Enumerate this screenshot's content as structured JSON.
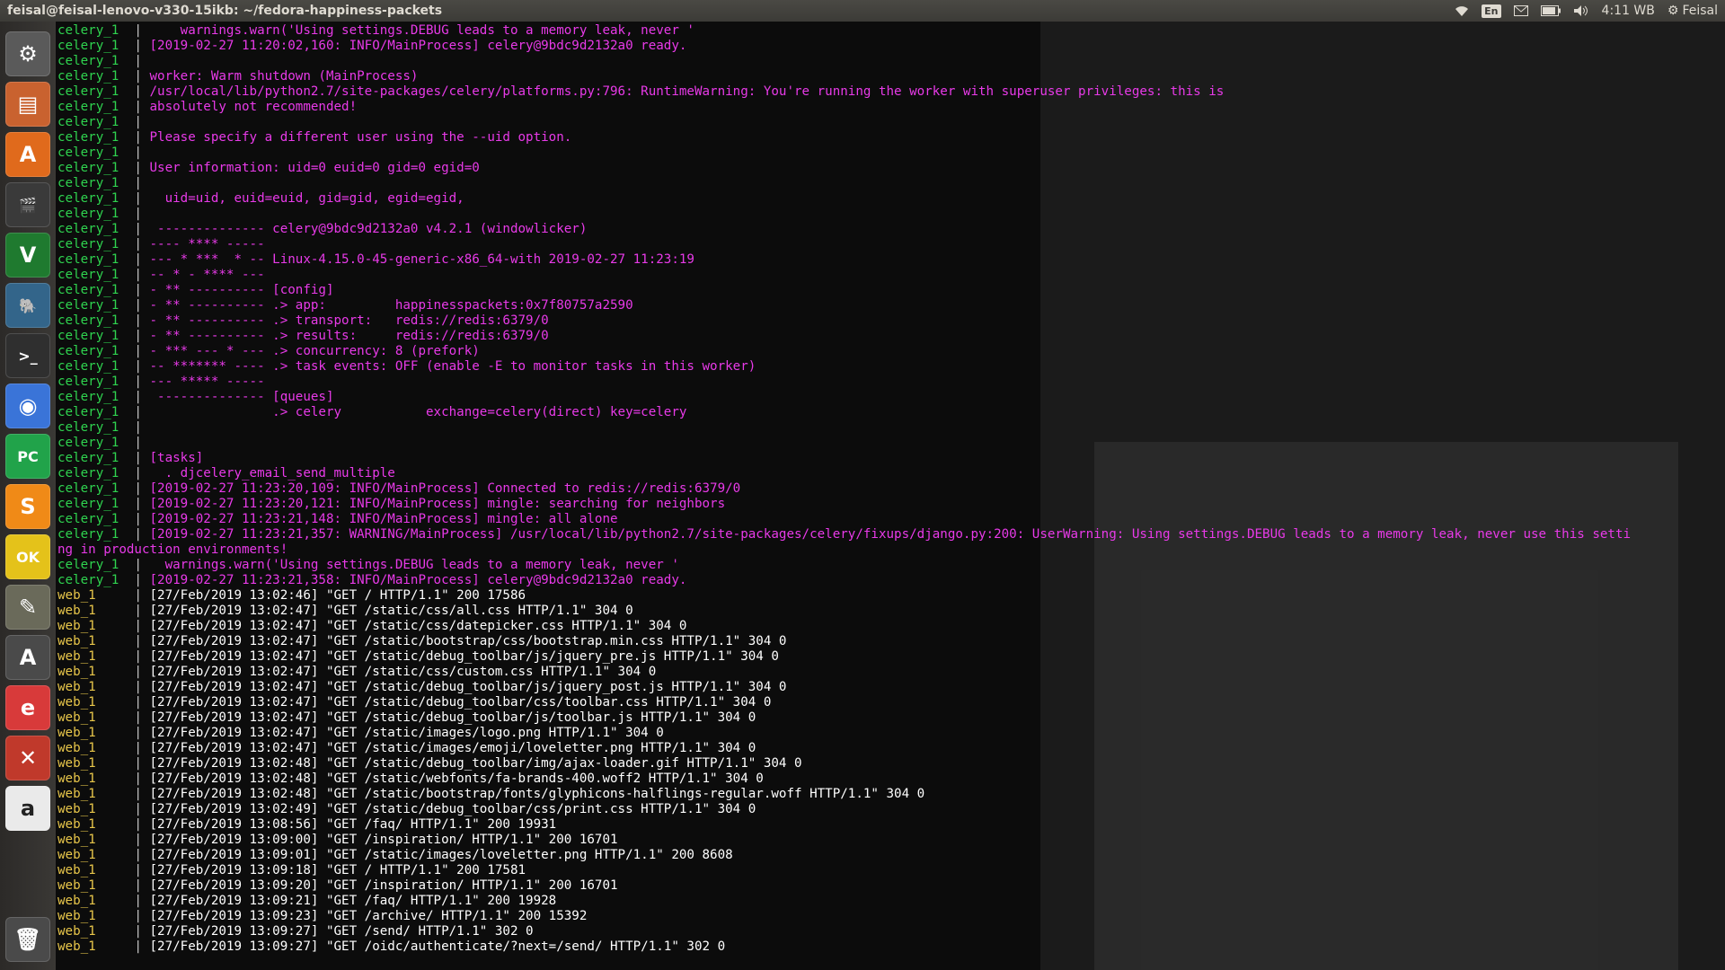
{
  "topbar": {
    "title": "feisal@feisal-lenovo-v330-15ikb: ~/fedora-happiness-packets",
    "lang": "En",
    "time": "4:11 WB",
    "user": "Feisal"
  },
  "launcher": {
    "items": [
      {
        "name": "system-settings-icon",
        "glyph": "⚙",
        "bg": "#5a5a5a"
      },
      {
        "name": "files-icon",
        "glyph": "▤",
        "bg": "#c9622f"
      },
      {
        "name": "software-center-icon",
        "glyph": "A",
        "bg": "#e06a1c"
      },
      {
        "name": "video-editor-icon",
        "glyph": "🎬",
        "bg": "#3a3a3a"
      },
      {
        "name": "vim-icon",
        "glyph": "V",
        "bg": "#1f7a2f"
      },
      {
        "name": "postgres-icon",
        "glyph": "🐘",
        "bg": "#33658a"
      },
      {
        "name": "terminal-icon",
        "glyph": ">_",
        "bg": "#2f2f2f"
      },
      {
        "name": "chrome-icon",
        "glyph": "◉",
        "bg": "#3a74d8"
      },
      {
        "name": "pycharm-icon",
        "glyph": "PC",
        "bg": "#21a34a"
      },
      {
        "name": "sublime-icon",
        "glyph": "S",
        "bg": "#f08a17"
      },
      {
        "name": "2do-icon",
        "glyph": "OK",
        "bg": "#e4c21a"
      },
      {
        "name": "gimp-icon",
        "glyph": "✎",
        "bg": "#6a6a5a"
      },
      {
        "name": "update-manager-icon",
        "glyph": "A",
        "bg": "#4a4a4a"
      },
      {
        "name": "evince-icon",
        "glyph": "e",
        "bg": "#d83a3a"
      },
      {
        "name": "tools-icon",
        "glyph": "✕",
        "bg": "#c0392b"
      },
      {
        "name": "amazon-icon",
        "glyph": "a",
        "bg": "#eaeaea"
      }
    ],
    "trash": {
      "name": "trash-icon",
      "glyph": "🗑"
    }
  },
  "log": [
    {
      "p": "celery_1",
      "m": "    warnings.warn('Using settings.DEBUG leads to a memory leak, never '"
    },
    {
      "p": "celery_1",
      "m": "[2019-02-27 11:20:02,160: INFO/MainProcess] celery@9bdc9d2132a0 ready."
    },
    {
      "p": "celery_1",
      "m": ""
    },
    {
      "p": "celery_1",
      "m": "worker: Warm shutdown (MainProcess)"
    },
    {
      "p": "celery_1",
      "m": "/usr/local/lib/python2.7/site-packages/celery/platforms.py:796: RuntimeWarning: You're running the worker with superuser privileges: this is"
    },
    {
      "p": "celery_1",
      "m": "absolutely not recommended!"
    },
    {
      "p": "celery_1",
      "m": ""
    },
    {
      "p": "celery_1",
      "m": "Please specify a different user using the --uid option."
    },
    {
      "p": "celery_1",
      "m": ""
    },
    {
      "p": "celery_1",
      "m": "User information: uid=0 euid=0 gid=0 egid=0"
    },
    {
      "p": "celery_1",
      "m": ""
    },
    {
      "p": "celery_1",
      "m": "  uid=uid, euid=euid, gid=gid, egid=egid,"
    },
    {
      "p": "celery_1",
      "m": ""
    },
    {
      "p": "celery_1",
      "m": " -------------- celery@9bdc9d2132a0 v4.2.1 (windowlicker)"
    },
    {
      "p": "celery_1",
      "m": "---- **** -----"
    },
    {
      "p": "celery_1",
      "m": "--- * ***  * -- Linux-4.15.0-45-generic-x86_64-with 2019-02-27 11:23:19"
    },
    {
      "p": "celery_1",
      "m": "-- * - **** ---"
    },
    {
      "p": "celery_1",
      "m": "- ** ---------- [config]"
    },
    {
      "p": "celery_1",
      "m": "- ** ---------- .> app:         happinesspackets:0x7f80757a2590"
    },
    {
      "p": "celery_1",
      "m": "- ** ---------- .> transport:   redis://redis:6379/0"
    },
    {
      "p": "celery_1",
      "m": "- ** ---------- .> results:     redis://redis:6379/0"
    },
    {
      "p": "celery_1",
      "m": "- *** --- * --- .> concurrency: 8 (prefork)"
    },
    {
      "p": "celery_1",
      "m": "-- ******* ---- .> task events: OFF (enable -E to monitor tasks in this worker)"
    },
    {
      "p": "celery_1",
      "m": "--- ***** -----"
    },
    {
      "p": "celery_1",
      "m": " -------------- [queues]"
    },
    {
      "p": "celery_1",
      "m": "                .> celery           exchange=celery(direct) key=celery"
    },
    {
      "p": "celery_1",
      "m": ""
    },
    {
      "p": "celery_1",
      "m": ""
    },
    {
      "p": "celery_1",
      "m": "[tasks]"
    },
    {
      "p": "celery_1",
      "m": "  . djcelery_email_send_multiple"
    },
    {
      "p": "celery_1",
      "m": "[2019-02-27 11:23:20,109: INFO/MainProcess] Connected to redis://redis:6379/0"
    },
    {
      "p": "celery_1",
      "m": "[2019-02-27 11:23:20,121: INFO/MainProcess] mingle: searching for neighbors"
    },
    {
      "p": "celery_1",
      "m": "[2019-02-27 11:23:21,148: INFO/MainProcess] mingle: all alone"
    },
    {
      "p": "celery_1",
      "m": "[2019-02-27 11:23:21,357: WARNING/MainProcess] /usr/local/lib/python2.7/site-packages/celery/fixups/django.py:200: UserWarning: Using settings.DEBUG leads to a memory leak, never use this setti"
    },
    {
      "p": "",
      "m": "ng in production environments!"
    },
    {
      "p": "celery_1",
      "m": "  warnings.warn('Using settings.DEBUG leads to a memory leak, never '"
    },
    {
      "p": "celery_1",
      "m": "[2019-02-27 11:23:21,358: INFO/MainProcess] celery@9bdc9d2132a0 ready."
    },
    {
      "p": "web_1",
      "m": "[27/Feb/2019 13:02:46] \"GET / HTTP/1.1\" 200 17586"
    },
    {
      "p": "web_1",
      "m": "[27/Feb/2019 13:02:47] \"GET /static/css/all.css HTTP/1.1\" 304 0"
    },
    {
      "p": "web_1",
      "m": "[27/Feb/2019 13:02:47] \"GET /static/css/datepicker.css HTTP/1.1\" 304 0"
    },
    {
      "p": "web_1",
      "m": "[27/Feb/2019 13:02:47] \"GET /static/bootstrap/css/bootstrap.min.css HTTP/1.1\" 304 0"
    },
    {
      "p": "web_1",
      "m": "[27/Feb/2019 13:02:47] \"GET /static/debug_toolbar/js/jquery_pre.js HTTP/1.1\" 304 0"
    },
    {
      "p": "web_1",
      "m": "[27/Feb/2019 13:02:47] \"GET /static/css/custom.css HTTP/1.1\" 304 0"
    },
    {
      "p": "web_1",
      "m": "[27/Feb/2019 13:02:47] \"GET /static/debug_toolbar/js/jquery_post.js HTTP/1.1\" 304 0"
    },
    {
      "p": "web_1",
      "m": "[27/Feb/2019 13:02:47] \"GET /static/debug_toolbar/css/toolbar.css HTTP/1.1\" 304 0"
    },
    {
      "p": "web_1",
      "m": "[27/Feb/2019 13:02:47] \"GET /static/debug_toolbar/js/toolbar.js HTTP/1.1\" 304 0"
    },
    {
      "p": "web_1",
      "m": "[27/Feb/2019 13:02:47] \"GET /static/images/logo.png HTTP/1.1\" 304 0"
    },
    {
      "p": "web_1",
      "m": "[27/Feb/2019 13:02:47] \"GET /static/images/emoji/loveletter.png HTTP/1.1\" 304 0"
    },
    {
      "p": "web_1",
      "m": "[27/Feb/2019 13:02:48] \"GET /static/debug_toolbar/img/ajax-loader.gif HTTP/1.1\" 304 0"
    },
    {
      "p": "web_1",
      "m": "[27/Feb/2019 13:02:48] \"GET /static/webfonts/fa-brands-400.woff2 HTTP/1.1\" 304 0"
    },
    {
      "p": "web_1",
      "m": "[27/Feb/2019 13:02:48] \"GET /static/bootstrap/fonts/glyphicons-halflings-regular.woff HTTP/1.1\" 304 0"
    },
    {
      "p": "web_1",
      "m": "[27/Feb/2019 13:02:49] \"GET /static/debug_toolbar/css/print.css HTTP/1.1\" 304 0"
    },
    {
      "p": "web_1",
      "m": "[27/Feb/2019 13:08:56] \"GET /faq/ HTTP/1.1\" 200 19931"
    },
    {
      "p": "web_1",
      "m": "[27/Feb/2019 13:09:00] \"GET /inspiration/ HTTP/1.1\" 200 16701"
    },
    {
      "p": "web_1",
      "m": "[27/Feb/2019 13:09:01] \"GET /static/images/loveletter.png HTTP/1.1\" 200 8608"
    },
    {
      "p": "web_1",
      "m": "[27/Feb/2019 13:09:18] \"GET / HTTP/1.1\" 200 17581"
    },
    {
      "p": "web_1",
      "m": "[27/Feb/2019 13:09:20] \"GET /inspiration/ HTTP/1.1\" 200 16701"
    },
    {
      "p": "web_1",
      "m": "[27/Feb/2019 13:09:21] \"GET /faq/ HTTP/1.1\" 200 19928"
    },
    {
      "p": "web_1",
      "m": "[27/Feb/2019 13:09:23] \"GET /archive/ HTTP/1.1\" 200 15392"
    },
    {
      "p": "web_1",
      "m": "[27/Feb/2019 13:09:27] \"GET /send/ HTTP/1.1\" 302 0"
    },
    {
      "p": "web_1",
      "m": "[27/Feb/2019 13:09:27] \"GET /oidc/authenticate/?next=/send/ HTTP/1.1\" 302 0"
    }
  ],
  "colors": {
    "celery_prefix": "#2fd34f",
    "web_prefix": "#e8c64a",
    "celery_msg": "#e83ae8",
    "web_msg": "#ffffff",
    "terminal_bg": "#0c0c0c"
  }
}
